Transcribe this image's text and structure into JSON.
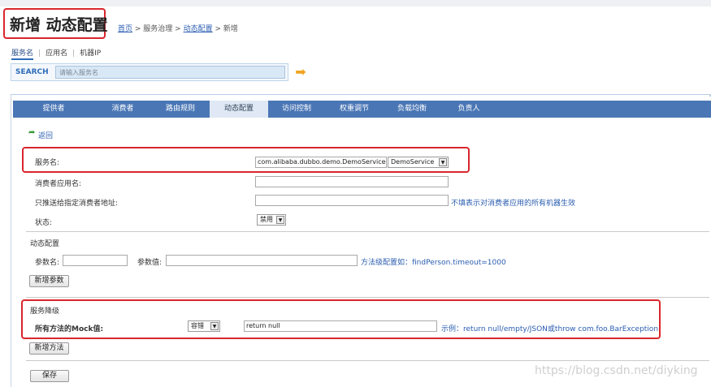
{
  "header": {
    "title": "新增 动态配置",
    "breadcrumb": {
      "home": "首页",
      "sep1": " > ",
      "gov": "服务治理",
      "sep2": " > ",
      "config": "动态配置",
      "sep3": " > ",
      "current": "新增"
    }
  },
  "search": {
    "tabs": [
      "服务名",
      "应用名",
      "机器IP"
    ],
    "label": "SEARCH",
    "placeholder": "请输入服务名"
  },
  "tabs": [
    "提供者",
    "消费者",
    "路由规则",
    "动态配置",
    "访问控制",
    "权重调节",
    "负载均衡",
    "负责人"
  ],
  "active_tab": "动态配置",
  "back": "返回",
  "form": {
    "service": {
      "label": "服务名:",
      "value": "com.alibaba.dubbo.demo.DemoService",
      "select": "DemoService"
    },
    "consumer_app": {
      "label": "消费者应用名:"
    },
    "push_addr": {
      "label": "只推送给指定消费者地址:",
      "hint": "不填表示对消费者应用的所有机器生效"
    },
    "status": {
      "label": "状态:",
      "select": "禁用"
    }
  },
  "dynamic": {
    "title": "动态配置",
    "param_name_label": "参数名:",
    "param_value_label": "参数值:",
    "hint": "方法级配置如：findPerson.timeout=1000",
    "add_button": "新增参数"
  },
  "degrade": {
    "title": "服务降级",
    "mock_label": "所有方法的Mock值:",
    "select": "容错",
    "value": "return null",
    "hint": "示例：return null/empty/JSON或throw com.foo.BarException",
    "add_button": "新增方法"
  },
  "save_button": "保存",
  "watermark": "https://blog.csdn.net/diyking"
}
